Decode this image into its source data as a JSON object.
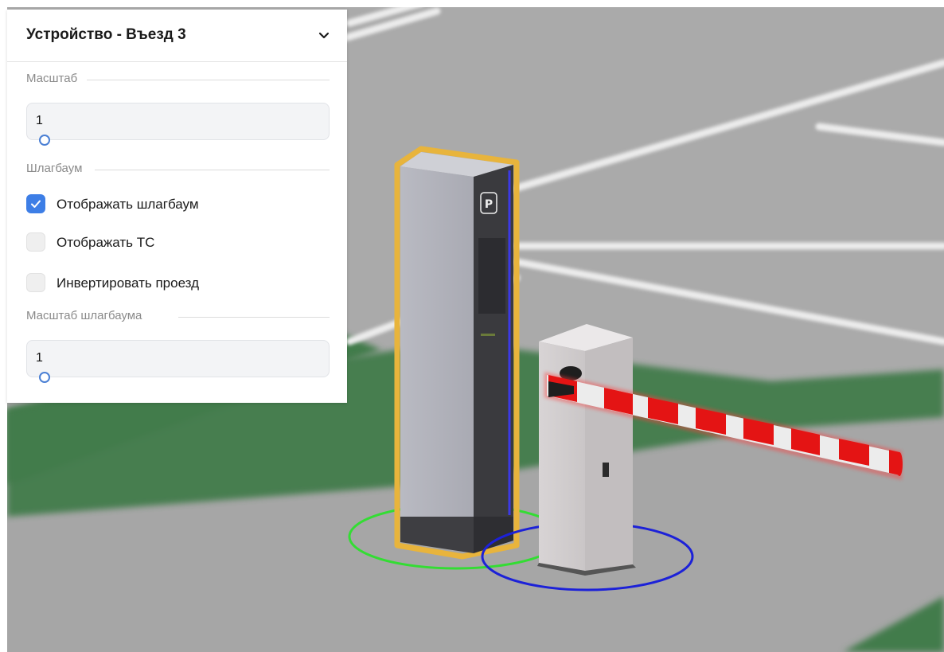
{
  "panel": {
    "title": "Устройство - Въезд 3",
    "collapse_icon": "chevron-down-icon",
    "scale_section": {
      "label": "Масштаб",
      "value": "1",
      "slider_level": 0
    },
    "barrier_section": {
      "label": "Шлагбаум",
      "options": [
        {
          "label": "Отображать шлагбаум",
          "checked": true
        },
        {
          "label": "Отображать ТС",
          "checked": false
        },
        {
          "label": "Инвертировать проезд",
          "checked": false
        }
      ]
    },
    "barrier_scale_section": {
      "label": "Масштаб шлагбаума",
      "value": "1",
      "slider_level": 0
    }
  },
  "scene": {
    "terminal_sign": "P",
    "colors": {
      "ground": "#a6a6a6",
      "lawn": "#427c4c",
      "lane_marking": "#ececec",
      "selection_outline": "#e8b43c",
      "terminal_ring": "#33dd33",
      "barrier_ring": "#1c21d8",
      "boom_red": "#e41414",
      "accent": "#3d7ee6"
    }
  }
}
